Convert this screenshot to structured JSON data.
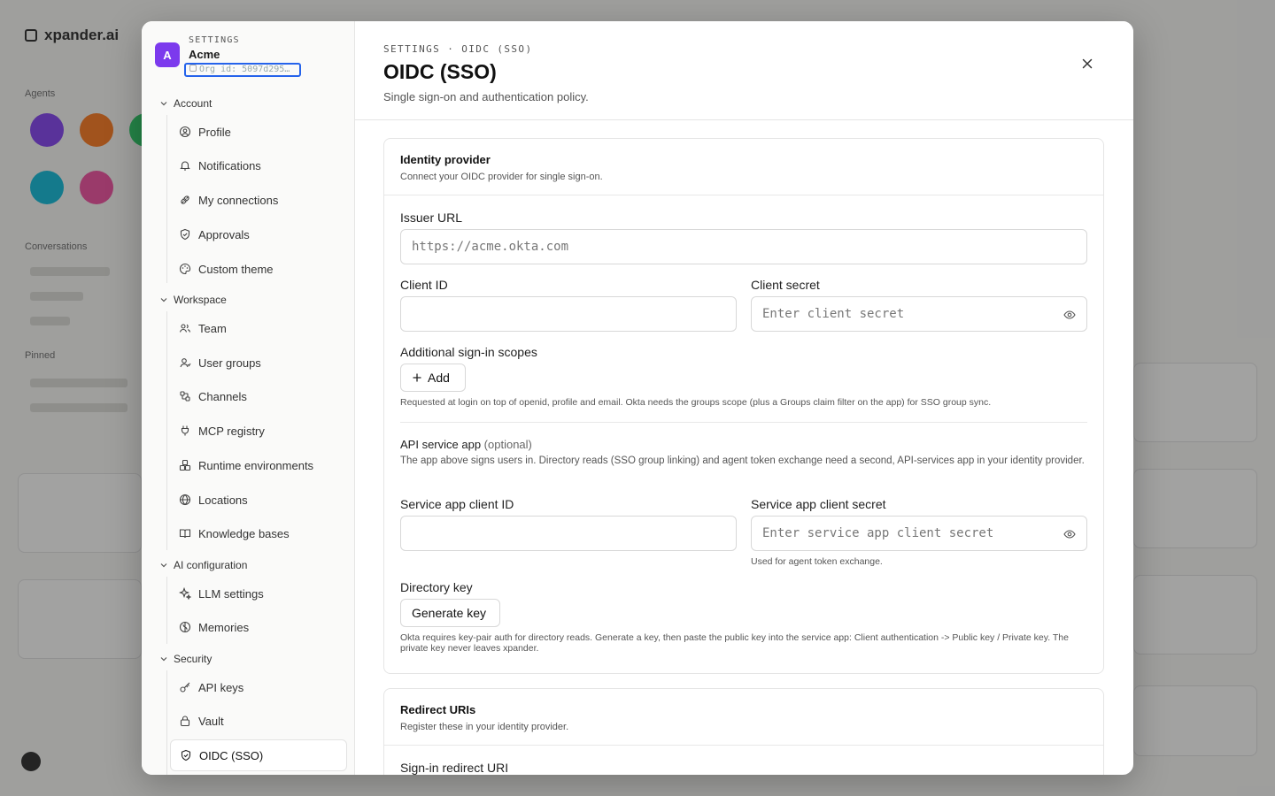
{
  "background": {
    "brand": "xpander.ai",
    "section_agents": "Agents",
    "section_conversations": "Conversations",
    "section_pinned": "Pinned",
    "user_initial": ""
  },
  "sidebar": {
    "org_eyebrow": "SETTINGS",
    "org_initial": "A",
    "org_name": "Acme",
    "org_id": "Org id: 5097d295…",
    "groups": [
      {
        "label": "Account",
        "items": [
          "Profile",
          "Notifications",
          "My connections",
          "Approvals",
          "Custom theme"
        ]
      },
      {
        "label": "Workspace",
        "items": [
          "Team",
          "User groups",
          "Channels",
          "MCP registry",
          "Runtime environments",
          "Locations",
          "Knowledge bases"
        ]
      },
      {
        "label": "AI configuration",
        "items": [
          "LLM settings",
          "Memories"
        ]
      },
      {
        "label": "Security",
        "items": [
          "API keys",
          "Vault",
          "OIDC (SSO)"
        ]
      }
    ]
  },
  "header": {
    "eyebrow": "SETTINGS · OIDC (SSO)",
    "title": "OIDC (SSO)",
    "subtitle": "Single sign-on and authentication policy."
  },
  "identity": {
    "title": "Identity provider",
    "desc": "Connect your OIDC provider for single sign-on.",
    "issuer_label": "Issuer URL",
    "issuer_placeholder": "https://acme.okta.com",
    "client_id_label": "Client ID",
    "client_id_value": "",
    "client_secret_label": "Client secret",
    "client_secret_placeholder": "Enter client secret",
    "scopes_label": "Additional sign-in scopes",
    "add_label": "Add",
    "scopes_hint": "Requested at login on top of openid, profile and email. Okta needs the groups scope (plus a Groups claim filter on the app) for SSO group sync.",
    "api_title": "API service app",
    "api_optional": "(optional)",
    "api_desc": "The app above signs users in. Directory reads (SSO group linking) and agent token exchange need a second, API-services app in your identity provider.",
    "svc_id_label": "Service app client ID",
    "svc_id_value": "",
    "svc_secret_label": "Service app client secret",
    "svc_secret_placeholder": "Enter service app client secret",
    "svc_secret_hint": "Used for agent token exchange.",
    "dirkey_label": "Directory key",
    "gen_label": "Generate key",
    "dirkey_hint": "Okta requires key-pair auth for directory reads. Generate a key, then paste the public key into the service app: Client authentication -> Public key / Private key. The private key never leaves xpander."
  },
  "redirect": {
    "title": "Redirect URIs",
    "desc": "Register these in your identity provider.",
    "signin_label": "Sign-in redirect URI"
  },
  "colors": {
    "accent": "#7c3aed",
    "focus": "#2563eb"
  }
}
